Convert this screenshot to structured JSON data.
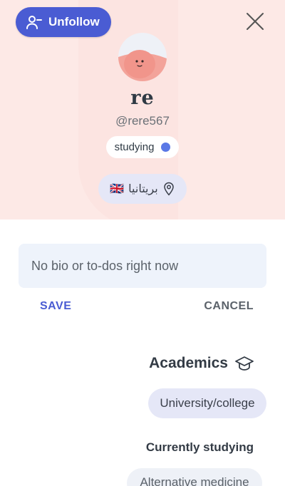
{
  "header": {
    "unfollow_label": "Unfollow",
    "icons": {
      "unfollow": "person-minus-icon",
      "close": "close-icon"
    }
  },
  "profile": {
    "name": "re",
    "handle": "@rere567",
    "status": {
      "label": "studying",
      "dot_color": "#5a78e6"
    },
    "location": {
      "label": "بريتانيا",
      "flag": "🇬🇧",
      "icon": "location-pin-icon"
    }
  },
  "bio": {
    "placeholder": "No bio or to-dos right now",
    "save_label": "SAVE",
    "cancel_label": "CANCEL"
  },
  "academics": {
    "title": "Academics",
    "icon": "graduation-cap-icon",
    "level": "University/college",
    "currently_studying_title": "Currently studying",
    "subject": "Alternative medicine"
  },
  "colors": {
    "accent": "#4a5cd3",
    "hero_bg": "#fde9e6",
    "pill_bg": "#e5e7f7"
  }
}
